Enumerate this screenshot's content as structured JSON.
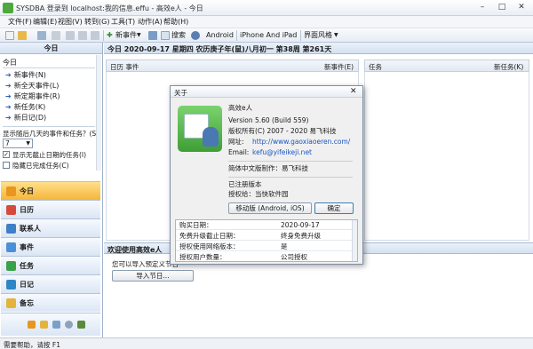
{
  "window": {
    "title": "SYSDBA 登录到 localhost:我的信息.effu - 高效e人 - 今日",
    "minimize": "–",
    "maximize": "□",
    "close": "✕"
  },
  "menu": [
    "文件(F)",
    "编辑(E)",
    "视图(V)",
    "转到(G)",
    "工具(T)",
    "动作(A)",
    "帮助(H)"
  ],
  "toolbar": {
    "new_label": "新事件",
    "search_label": "搜索",
    "android_label": "Android",
    "iphone_label": "iPhone And iPad",
    "style_label": "界面风格"
  },
  "left_panel": {
    "title": "今日",
    "section": "今日",
    "links": [
      "新事件(N)",
      "新全天事件(L)",
      "新定期事件(R)",
      "新任务(K)",
      "新日记(D)"
    ],
    "days_label": "显示随后几天的事件和任务？(S)",
    "days_value": "7",
    "show_no_deadline": "显示无截止日期的任务(I)",
    "hide_completed": "隐藏已完成任务(C)",
    "nav": [
      "今日",
      "日历",
      "联系人",
      "事件",
      "任务",
      "日记",
      "备忘"
    ]
  },
  "main": {
    "head": "今日  2020-09-17 星期四 农历庚子年(鼠)八月初一 第38周 第261天",
    "cal_col": "日历  事件",
    "new_event": "新事件(E)",
    "task_col": "任务",
    "new_task": "新任务(K)",
    "welcome_title": "欢迎使用高效e人",
    "welcome_text": "您可以导入预定义节日",
    "import_btn": "导入节日..."
  },
  "dialog": {
    "title": "关于",
    "app_name": "高效e人",
    "version": "Version 5.60 (Build 559)",
    "copyright": "版权所有(C) 2007 - 2020 易飞科技",
    "site_label": "网址:",
    "site": "http://www.gaoxiaoeren.com/",
    "email_label": "Email:",
    "email": "kefu@yifeikeji.net",
    "chinese_by": "简体中文版制作：易飞科技",
    "registered": "已注册版本",
    "licensee": "授权给：当快软件园",
    "mobile_btn": "移动版 (Android, iOS)",
    "ok_btn": "确定",
    "table": [
      [
        "购买日期：",
        "2020-09-17"
      ],
      [
        "免费升级截止日期：",
        "终身免费升级"
      ],
      [
        "授权使用网络版本：",
        "是"
      ],
      [
        "授权用户数量：",
        "公司授权"
      ]
    ]
  },
  "status": "需要帮助，请按 F1",
  "colors": {
    "accent": "#2a5db0",
    "panel_head": "#d4e1f1",
    "active_nav": "#f6b53a"
  }
}
